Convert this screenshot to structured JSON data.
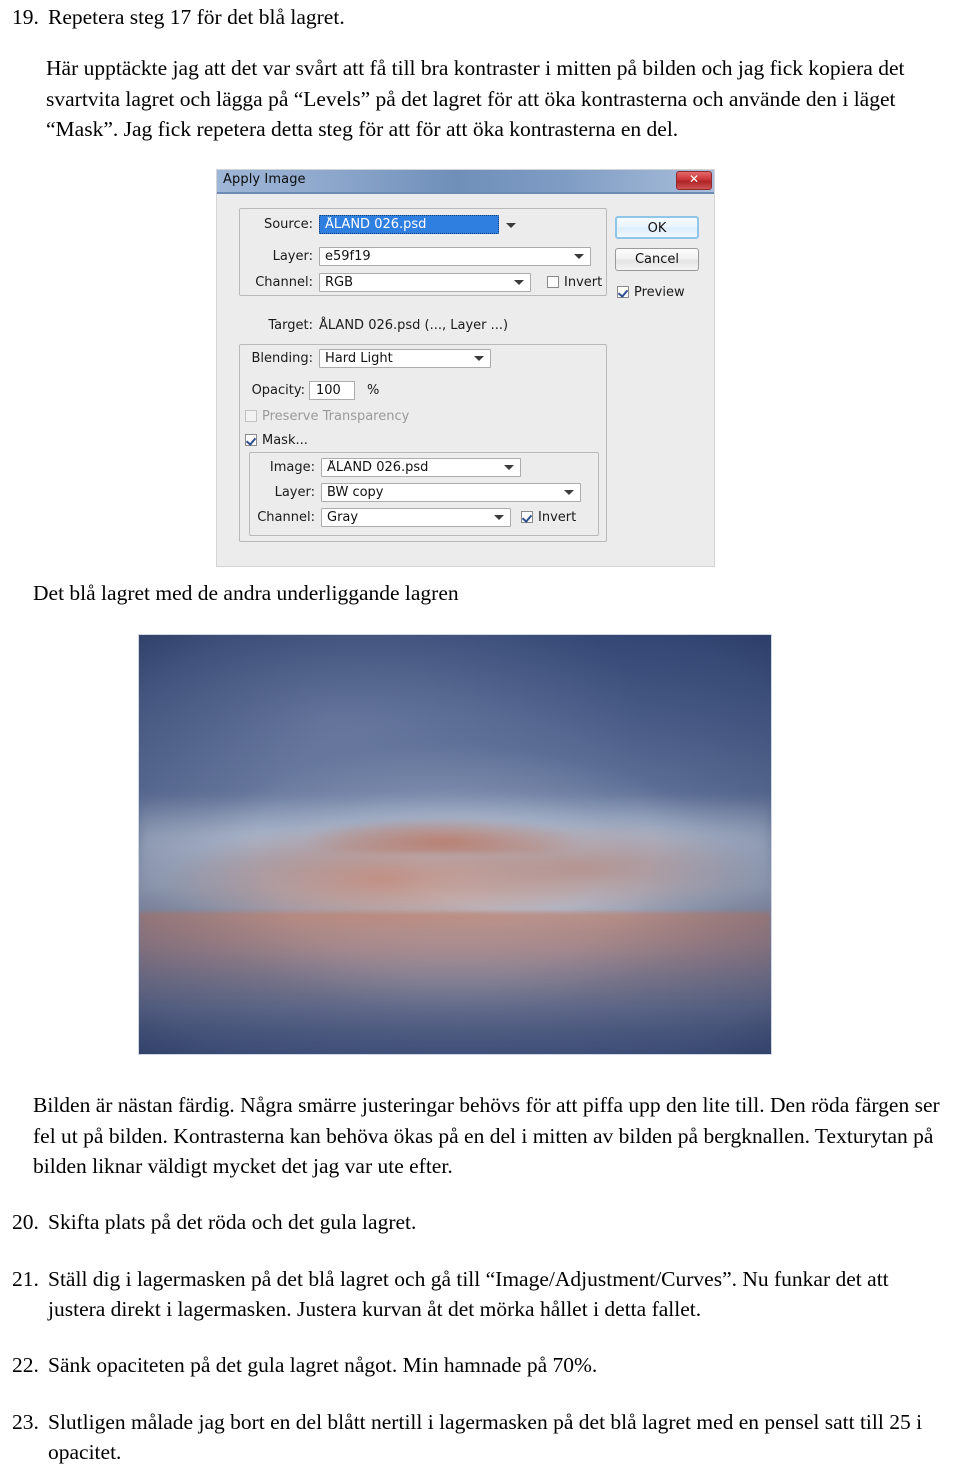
{
  "document": {
    "step19": {
      "number": "19.",
      "text": "Repetera steg 17 för det blå lagret."
    },
    "paragraph1": "Här upptäckte jag att det var svårt att få till bra kontraster i mitten på bilden och jag fick kopiera det svartvita lagret och lägga på “Levels” på det lagret för att öka kontrasterna och använde den i läget “Mask”. Jag fick repetera detta steg för att för att öka kontrasterna en del.",
    "caption1": "Det blå lagret med de andra underliggande lagren",
    "paragraph2": "Bilden är nästan färdig. Några smärre justeringar behövs för att piffa upp den lite till. Den röda färgen ser fel ut på bilden. Kontrasterna kan behöva ökas på en del i mitten av bilden på bergknallen. Texturytan på bilden liknar väldigt mycket det jag var ute efter.",
    "step20": {
      "number": "20.",
      "text": "Skifta plats på det röda och det gula lagret."
    },
    "step21": {
      "number": "21.",
      "text": "Ställ dig i lagermasken på det blå lagret och gå till “Image/Adjustment/Curves”. Nu funkar det att justera direkt i lagermasken. Justera kurvan åt det mörka hållet i detta fallet."
    },
    "step22": {
      "number": "22.",
      "text": "Sänk opaciteten på det gula lagret något. Min hamnade på 70%."
    },
    "step23": {
      "number": "23.",
      "text": "Slutligen målade jag bort en del blått nertill i lagermasken på det blå lagret med en pensel satt till 25 i opacitet."
    }
  },
  "dialog": {
    "title": "Apply Image",
    "close_label": "✕",
    "source_group": {
      "source_label": "Source:",
      "source_value": "ÅLAND 026.psd",
      "layer_label": "Layer:",
      "layer_value": "e59f19",
      "channel_label": "Channel:",
      "channel_value": "RGB",
      "invert_label": "Invert",
      "invert_checked": false
    },
    "target": {
      "label": "Target:",
      "value": "ÅLAND 026.psd (..., Layer ...)"
    },
    "blending": {
      "label": "Blending:",
      "value": "Hard Light"
    },
    "opacity": {
      "label": "Opacity:",
      "value": "100",
      "unit": "%"
    },
    "preserve_transparency": {
      "label": "Preserve Transparency",
      "checked": false,
      "disabled": true
    },
    "mask": {
      "label": "Mask...",
      "checked": true,
      "image_label": "Image:",
      "image_value": "ÅLAND 026.psd",
      "layer_label": "Layer:",
      "layer_value": "BW copy",
      "channel_label": "Channel:",
      "channel_value": "Gray",
      "invert_label": "Invert",
      "invert_checked": true
    },
    "buttons": {
      "ok": "OK",
      "cancel": "Cancel",
      "preview_label": "Preview",
      "preview_checked": true
    },
    "colors": {
      "titlebar_blue": "#6f8fb9",
      "close_red": "#c93537",
      "dialog_face": "#ececec",
      "selection_blue": "#2f7fe0"
    }
  }
}
